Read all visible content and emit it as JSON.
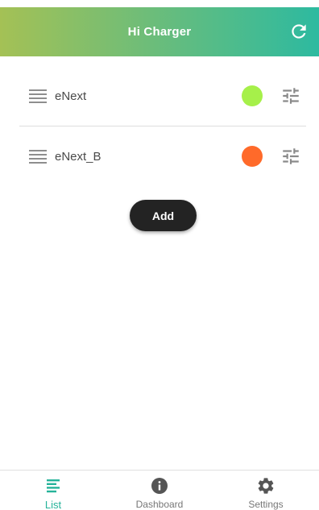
{
  "header": {
    "title": "Hi Charger",
    "gradient_start": "#a4c155",
    "gradient_end": "#2dbaa0"
  },
  "icons": {
    "refresh": "refresh-icon",
    "drag": "drag-handle-icon",
    "tune": "tune-icon"
  },
  "chargers": [
    {
      "name": "eNext",
      "status_color": "#a6f04a"
    },
    {
      "name": "eNext_B",
      "status_color": "#ff6a2a"
    }
  ],
  "actions": {
    "add_label": "Add"
  },
  "nav": {
    "items": [
      {
        "label": "List",
        "icon": "list-icon",
        "active": true
      },
      {
        "label": "Dashboard",
        "icon": "info-icon",
        "active": false
      },
      {
        "label": "Settings",
        "icon": "gear-icon",
        "active": false
      }
    ],
    "active_color": "#26b39a",
    "inactive_color": "#666666"
  }
}
